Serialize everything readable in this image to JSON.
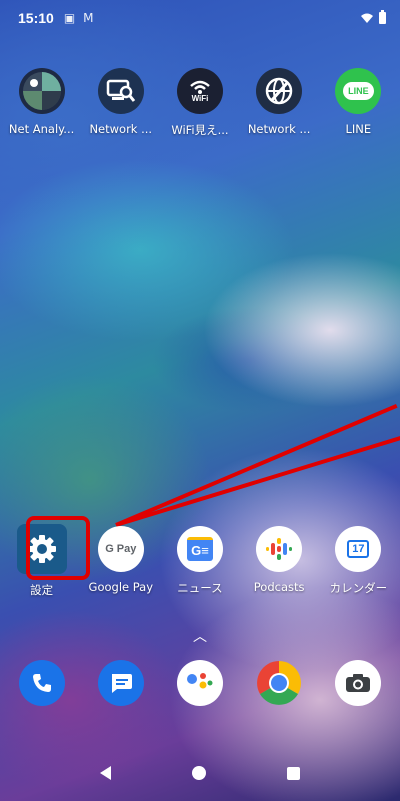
{
  "status_bar": {
    "time": "15:10",
    "notification_icons": [
      "clipboard-icon",
      "gmail-icon"
    ],
    "right_icons": [
      "wifi-icon",
      "battery-icon"
    ]
  },
  "top_row": [
    {
      "label": "Net Analy...",
      "icon": "net-analyzer-icon"
    },
    {
      "label": "Network ...",
      "icon": "network-scanner-icon"
    },
    {
      "label": "WiFi見え...",
      "icon": "wifi-app-icon",
      "icon_text": "WiFi"
    },
    {
      "label": "Network ...",
      "icon": "network-tools-icon"
    },
    {
      "label": "LINE",
      "icon": "line-icon",
      "icon_text": "LINE"
    }
  ],
  "middle_row": [
    {
      "label": "設定",
      "icon": "settings-gear-icon"
    },
    {
      "label": "Google Pay",
      "icon": "google-pay-icon",
      "icon_text": "G Pay"
    },
    {
      "label": "ニュース",
      "icon": "news-icon",
      "icon_text": "G≡"
    },
    {
      "label": "Podcasts",
      "icon": "podcasts-icon"
    },
    {
      "label": "カレンダー",
      "icon": "calendar-icon",
      "icon_text": "17"
    }
  ],
  "dock": [
    {
      "icon": "phone-icon"
    },
    {
      "icon": "messages-icon"
    },
    {
      "icon": "google-assistant-icon"
    },
    {
      "icon": "chrome-icon"
    },
    {
      "icon": "camera-icon"
    }
  ],
  "swipe_indicator": "︿",
  "colors": {
    "annotation_red": "#e00000",
    "line_green": "#2fc24d",
    "settings_blue": "#1a73e8"
  }
}
